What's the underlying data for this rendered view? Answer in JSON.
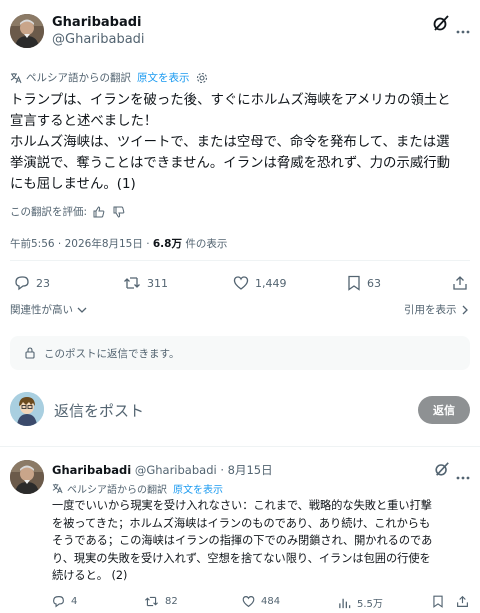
{
  "main_post": {
    "author_name": "Gharibabadi",
    "author_handle": "@Gharibabadi",
    "translated_from": "ペルシア語からの翻訳",
    "show_original": "原文を表示",
    "body_lines": [
      "トランプは、イランを破った後、すぐにホルムズ海峡をアメリカの領土と",
      "宣言すると述べました！",
      "ホルムズ海峡は、ツイートで、または空母で、命令を発布して、または選",
      "挙演説で、奪うことはできません。イランは脅威を恐れず、力の示威行動",
      "にも屈しません。(1)"
    ],
    "rate_translation": "この翻訳を評価:",
    "timestamp": "午前5:56 · 2026年8月15日 · ",
    "views_count": "6.8万",
    "views_label": " 件の表示",
    "stats": {
      "replies": "23",
      "reposts": "311",
      "likes": "1,449",
      "bookmarks": "63"
    },
    "sort_label": "関連性が高い",
    "quotes_label": "引用を表示"
  },
  "reply_restriction": "このポストに返信できます。",
  "composer": {
    "placeholder": "返信をポスト",
    "reply_button": "返信"
  },
  "reply_post": {
    "author_name": "Gharibabadi",
    "author_handle": "@Gharibabadi",
    "date": "· 8月15日",
    "translated_from": "ペルシア語からの翻訳",
    "show_original": "原文を表示",
    "body_lines": [
      "一度でいいから現実を受け入れなさい：これまで、戦略的な失敗と重い打撃",
      "を被ってきた；ホルムズ海峡はイランのものであり、あり続け、これからも",
      "そうである；この海峡はイランの指揮の下でのみ閉鎖され、開かれるのであ",
      "り、現実の失敗を受け入れず、空想を捨てない限り、イランは包囲の行使を",
      "続けると。 (2)"
    ],
    "stats": {
      "replies": "4",
      "reposts": "82",
      "likes": "484",
      "views": "5.5万"
    }
  },
  "colors": {
    "accent": "#1d9bf0",
    "muted": "#536471",
    "text": "#0f1419",
    "disabled_button": "#8e9193"
  }
}
